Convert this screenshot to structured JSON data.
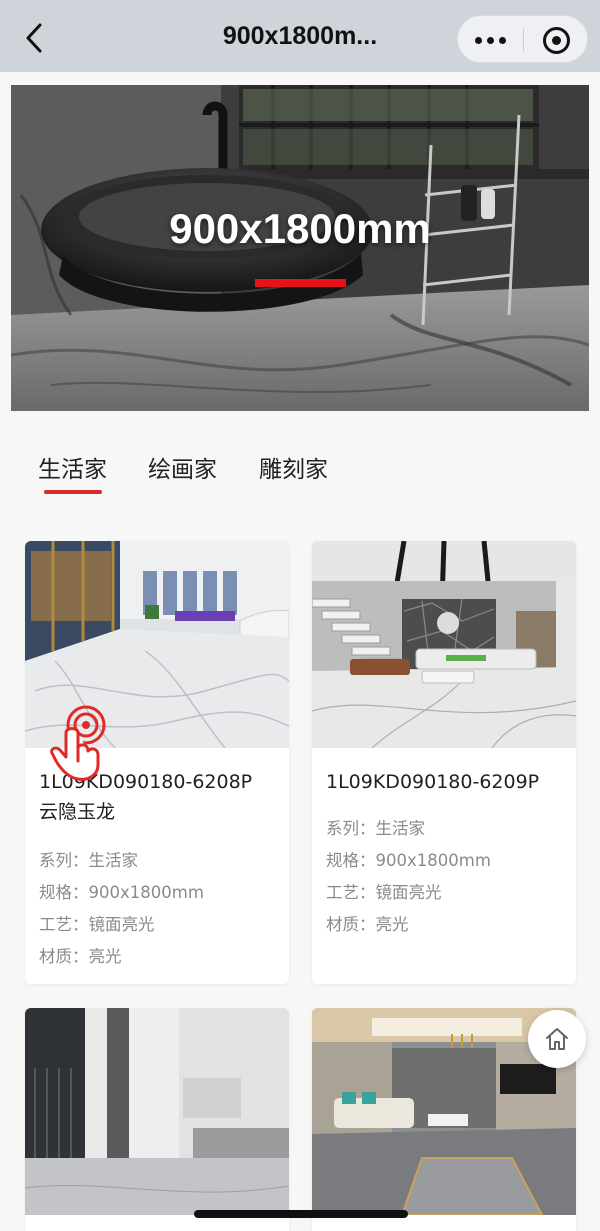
{
  "navbar": {
    "title": "900x1800m...",
    "back_icon": "chevron-left-icon",
    "more_icon": "more-dots-icon",
    "close_icon": "target-circle-icon",
    "background": "#cfd3da"
  },
  "banner": {
    "title": "900x1800mm",
    "accent_color": "#e5141b"
  },
  "tabs": [
    {
      "label": "生活家",
      "active": true
    },
    {
      "label": "绘画家",
      "active": false
    },
    {
      "label": "雕刻家",
      "active": false
    }
  ],
  "products": [
    {
      "code": "1L09KD090180-6208P",
      "name": "云隐玉龙",
      "specs": [
        {
          "label": "系列：",
          "value": "生活家"
        },
        {
          "label": "规格：",
          "value": "900x1800mm"
        },
        {
          "label": "工艺：",
          "value": "镜面亮光"
        },
        {
          "label": "材质：",
          "value": "亮光"
        }
      ]
    },
    {
      "code": "1L09KD090180-6209P",
      "name": "",
      "specs": [
        {
          "label": "系列：",
          "value": "生活家"
        },
        {
          "label": "规格：",
          "value": "900x1800mm"
        },
        {
          "label": "工艺：",
          "value": "镜面亮光"
        },
        {
          "label": "材质：",
          "value": "亮光"
        }
      ]
    },
    {
      "code": "",
      "name": "",
      "specs": []
    },
    {
      "code": "",
      "name": "",
      "specs": []
    }
  ],
  "floating": {
    "home_icon": "home-icon"
  },
  "accent": "#d62b2b"
}
